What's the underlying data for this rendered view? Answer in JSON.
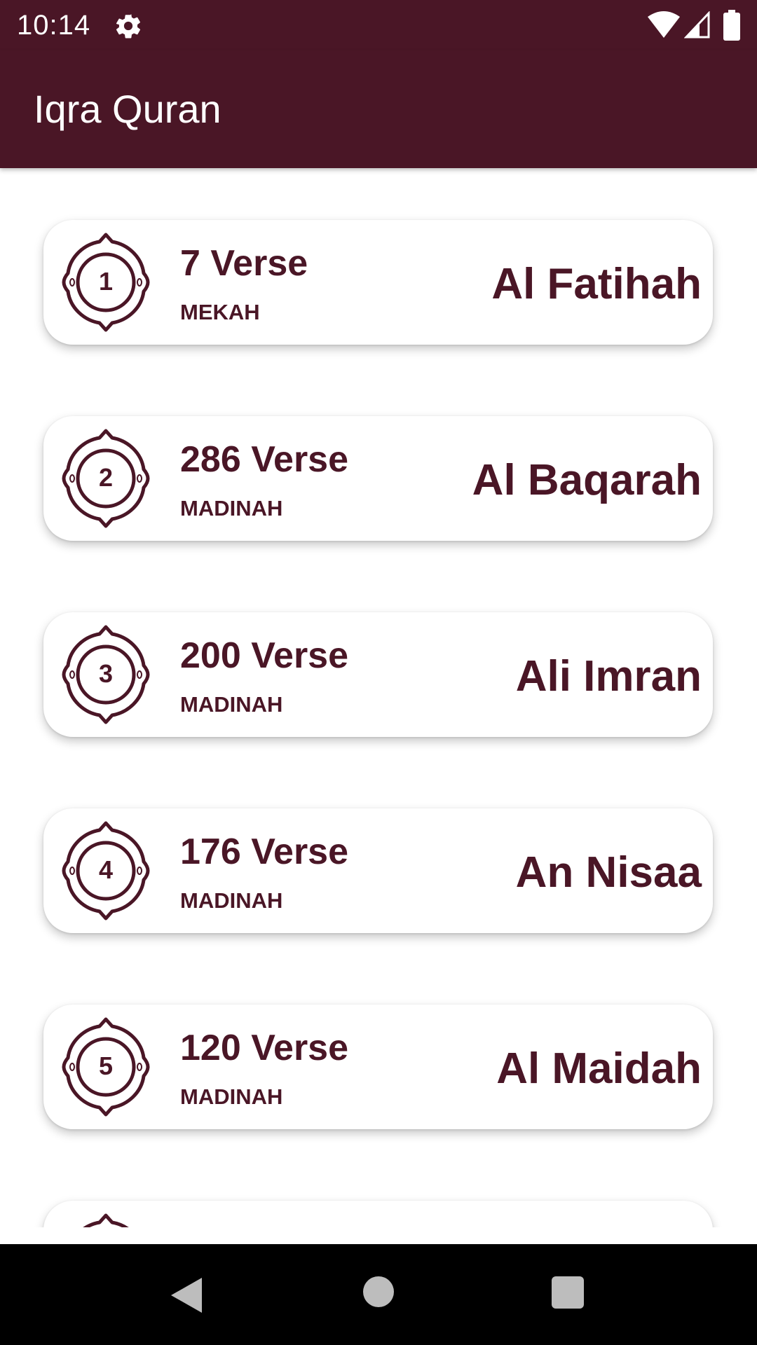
{
  "status_bar": {
    "time": "10:14",
    "icons": [
      "gear-icon",
      "wifi-icon",
      "signal-icon",
      "battery-icon"
    ]
  },
  "app_bar": {
    "title": "Iqra Quran"
  },
  "surahs": [
    {
      "number": "1",
      "verses": "7 Verse",
      "place": "MEKAH",
      "name": "Al Fatihah"
    },
    {
      "number": "2",
      "verses": "286 Verse",
      "place": "MADINAH",
      "name": "Al Baqarah"
    },
    {
      "number": "3",
      "verses": "200 Verse",
      "place": "MADINAH",
      "name": "Ali Imran"
    },
    {
      "number": "4",
      "verses": "176 Verse",
      "place": "MADINAH",
      "name": "An Nisaa"
    },
    {
      "number": "5",
      "verses": "120 Verse",
      "place": "MADINAH",
      "name": "Al Maidah"
    }
  ],
  "nav_bar": {
    "buttons": [
      "back-icon",
      "home-icon",
      "recents-icon"
    ]
  },
  "colors": {
    "primary": "#4a1626",
    "background": "#ffffff",
    "nav_background": "#000000",
    "nav_icon": "#bdbdbd"
  }
}
